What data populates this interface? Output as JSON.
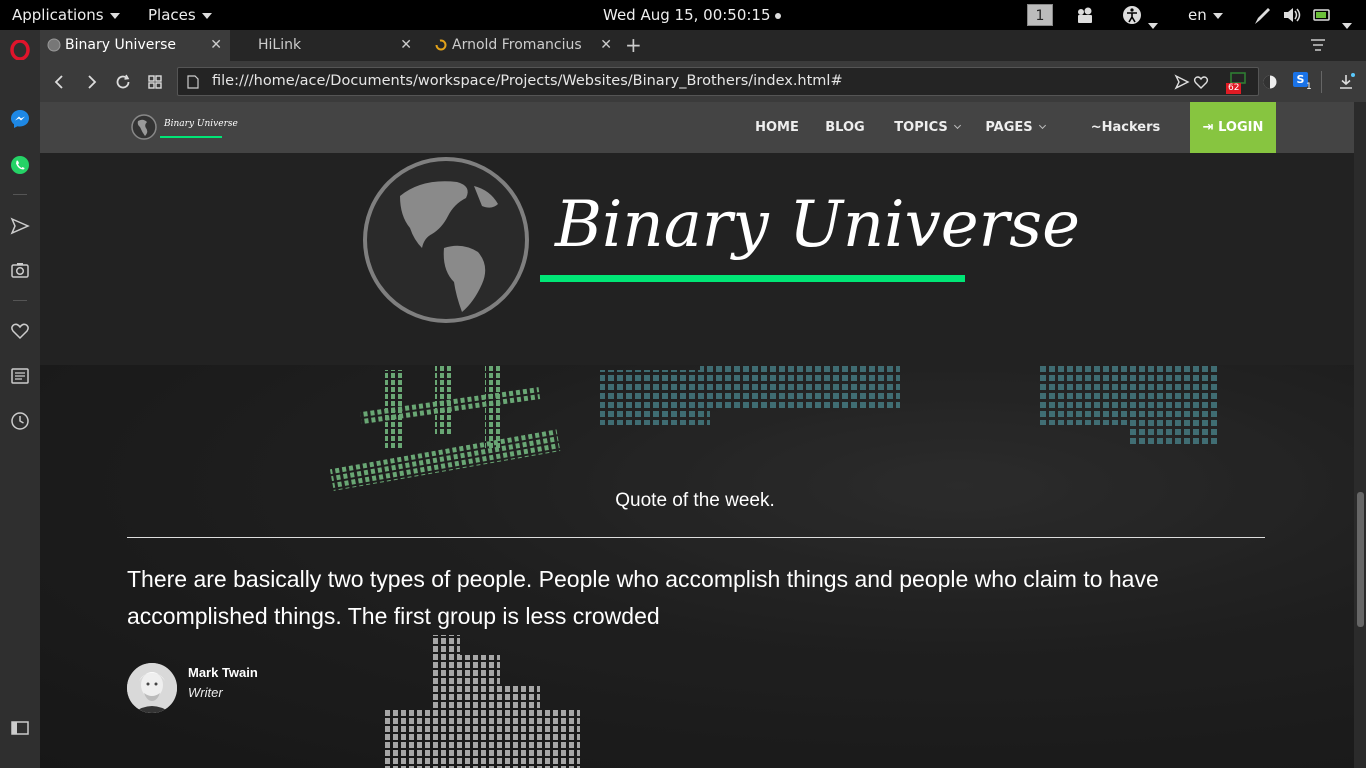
{
  "topbar": {
    "applications": "Applications",
    "places": "Places",
    "clock": "Wed Aug 15, 00:50:15",
    "workspace": "1",
    "language": "en"
  },
  "browser": {
    "tabs": [
      {
        "label": "Binary Universe",
        "active": true
      },
      {
        "label": "HiLink",
        "active": false
      },
      {
        "label": "Arnold Fromancius",
        "active": false
      }
    ],
    "url": "file:///home/ace/Documents/workspace/Projects/Websites/Binary_Brothers/index.html#",
    "badge_count": "62",
    "ext_count": "1"
  },
  "site": {
    "logo_text": "Binary Universe",
    "nav": [
      {
        "label": "HOME"
      },
      {
        "label": "BLOG"
      },
      {
        "label": "TOPICS"
      },
      {
        "label": "PAGES"
      },
      {
        "label": "~Hackers LaiR~"
      }
    ],
    "login_label": "LOGIN",
    "brand_title": "Binary Universe"
  },
  "quote": {
    "heading": "Quote of the week.",
    "text": "There are basically two types of people. People who accomplish things and people who claim to have accomplished things. The first group is less crowded",
    "author_name": "Mark Twain",
    "author_role": "Writer"
  },
  "colors": {
    "accent_green": "#00e676",
    "login_green": "#87c540",
    "opera_red": "#e0142b"
  }
}
